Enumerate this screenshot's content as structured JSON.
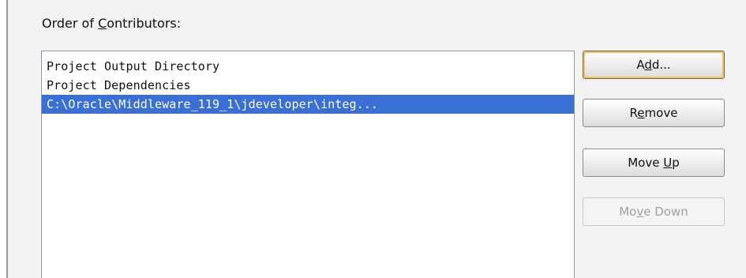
{
  "section": {
    "label_before": "Order of ",
    "label_mnemonic": "C",
    "label_after": "ontributors:"
  },
  "contributors": {
    "items": [
      "Project Output Directory",
      "Project Dependencies",
      "C:\\Oracle\\Middleware_119_1\\jdeveloper\\integ..."
    ],
    "selected_index": 2
  },
  "buttons": {
    "add": {
      "before": "A",
      "mnemonic": "d",
      "after": "d...",
      "enabled": true,
      "default": true
    },
    "remove": {
      "before": "R",
      "mnemonic": "e",
      "after": "move",
      "enabled": true
    },
    "move_up": {
      "before": "Move ",
      "mnemonic": "U",
      "after": "p",
      "enabled": true
    },
    "move_down": {
      "before": "Mo",
      "mnemonic": "v",
      "after": "e Down",
      "enabled": false
    }
  },
  "colors": {
    "selection": "#3a6fd6",
    "panel_background": "#f2f2f2",
    "disabled_text": "#a0a0a0"
  }
}
